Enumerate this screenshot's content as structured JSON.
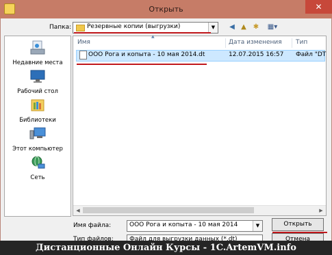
{
  "window": {
    "title": "Открыть",
    "close_glyph": "✕"
  },
  "folder": {
    "label": "Папка:",
    "value": "Резервные копии (выгрузки)"
  },
  "toolbar": {
    "back_glyph": "◀",
    "up_glyph": "▲",
    "new_folder_glyph": "✱",
    "view_glyph": "▦▾"
  },
  "places": [
    {
      "label": "Недавние места",
      "icon": "recent-places-icon"
    },
    {
      "label": "Рабочий стол",
      "icon": "desktop-icon"
    },
    {
      "label": "Библиотеки",
      "icon": "libraries-icon"
    },
    {
      "label": "Этот компьютер",
      "icon": "computer-icon"
    },
    {
      "label": "Сеть",
      "icon": "network-icon"
    }
  ],
  "list": {
    "columns": [
      "Имя",
      "Дата изменения",
      "Тип"
    ],
    "rows": [
      {
        "name": "ООО Рога и копыта - 10 мая 2014.dt",
        "date": "12.07.2015 16:57",
        "type": "Файл \"DT"
      }
    ]
  },
  "filename": {
    "label": "Имя файла:",
    "value": "ООО Рога и копыта - 10 мая 2014"
  },
  "filetype": {
    "label": "Тип файлов:",
    "value": "Файл для выгрузки данных (*.dt)"
  },
  "buttons": {
    "open": "Открыть",
    "cancel": "Отмена"
  },
  "banner": {
    "text": "Дистанционные Онлайн Курсы - 1C.ArtemVM.info"
  },
  "colors": {
    "titlebar": "#c67c67",
    "close": "#c7483a",
    "underline": "#c0171b",
    "selection": "#cde8ff",
    "banner": "#252525"
  }
}
